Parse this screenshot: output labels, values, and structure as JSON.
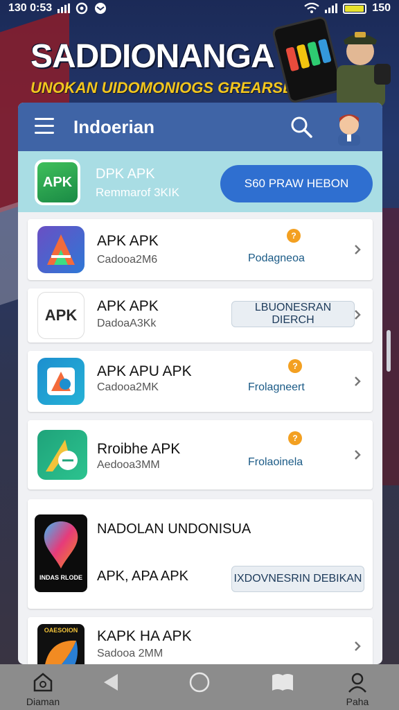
{
  "status_bar": {
    "time": "130 0:53",
    "right_text": "150",
    "battery_level": 0.9
  },
  "banner": {
    "title": "SADDIONANGA",
    "subtitle": "UNOKAN UIDOMONIOGS GREARSEIO",
    "colors": {
      "title": "#ffffff",
      "subtitle": "#f2c61f"
    }
  },
  "app_bar": {
    "title": "Indoerian",
    "menu_icon": "hamburger-menu-icon",
    "search_icon": "search-icon",
    "avatar_icon": "avatar-icon"
  },
  "featured": {
    "logo_text": "APK",
    "name": "DPK APK",
    "subtitle": "Remmarof 3KIK",
    "button_label": "S60 PRAW HEBON",
    "accent": "#2f6fd0"
  },
  "list_items": [
    {
      "name": "APK APK",
      "size": "Cadooa2M6",
      "tag": "Podagneoa",
      "coin": "?",
      "icon": "apk-a-logo-icon"
    },
    {
      "icon_text": "APK",
      "name": "APK APK",
      "size": "DadoaA3Kk",
      "button_label": "LBUONESRAN DIERCH",
      "icon": "apk-text-logo-icon"
    },
    {
      "name": "APK APU APK",
      "size": "Cadooa2MK",
      "tag": "Frolagneert",
      "coin": "?",
      "icon": "apk-box-logo-icon"
    },
    {
      "name": "Rroibhe APK",
      "size": "Aedooa3MM",
      "tag": "Frolaoinela",
      "coin": "?",
      "icon": "apk-green-logo-icon"
    },
    {
      "name": "NADOLAN UNDONISUA",
      "second_line": "APK, APA APK",
      "icon_text": "INDAS RLODE",
      "button_label": "IXDOVNESRIN DEBIKAN",
      "icon": "map-pin-logo-icon"
    },
    {
      "icon_text": "OAESOION",
      "name": "KAPK HA APK",
      "size": "Sadooa 2MM",
      "icon": "orange-arc-logo-icon"
    }
  ],
  "bottom_nav": [
    {
      "label": "Diaman",
      "icon": "home-icon"
    },
    {
      "label": "",
      "icon": "back-icon"
    },
    {
      "label": "",
      "icon": "circle-home-icon"
    },
    {
      "label": "",
      "icon": "book-icon"
    },
    {
      "label": "Paha",
      "icon": "profile-icon"
    }
  ]
}
